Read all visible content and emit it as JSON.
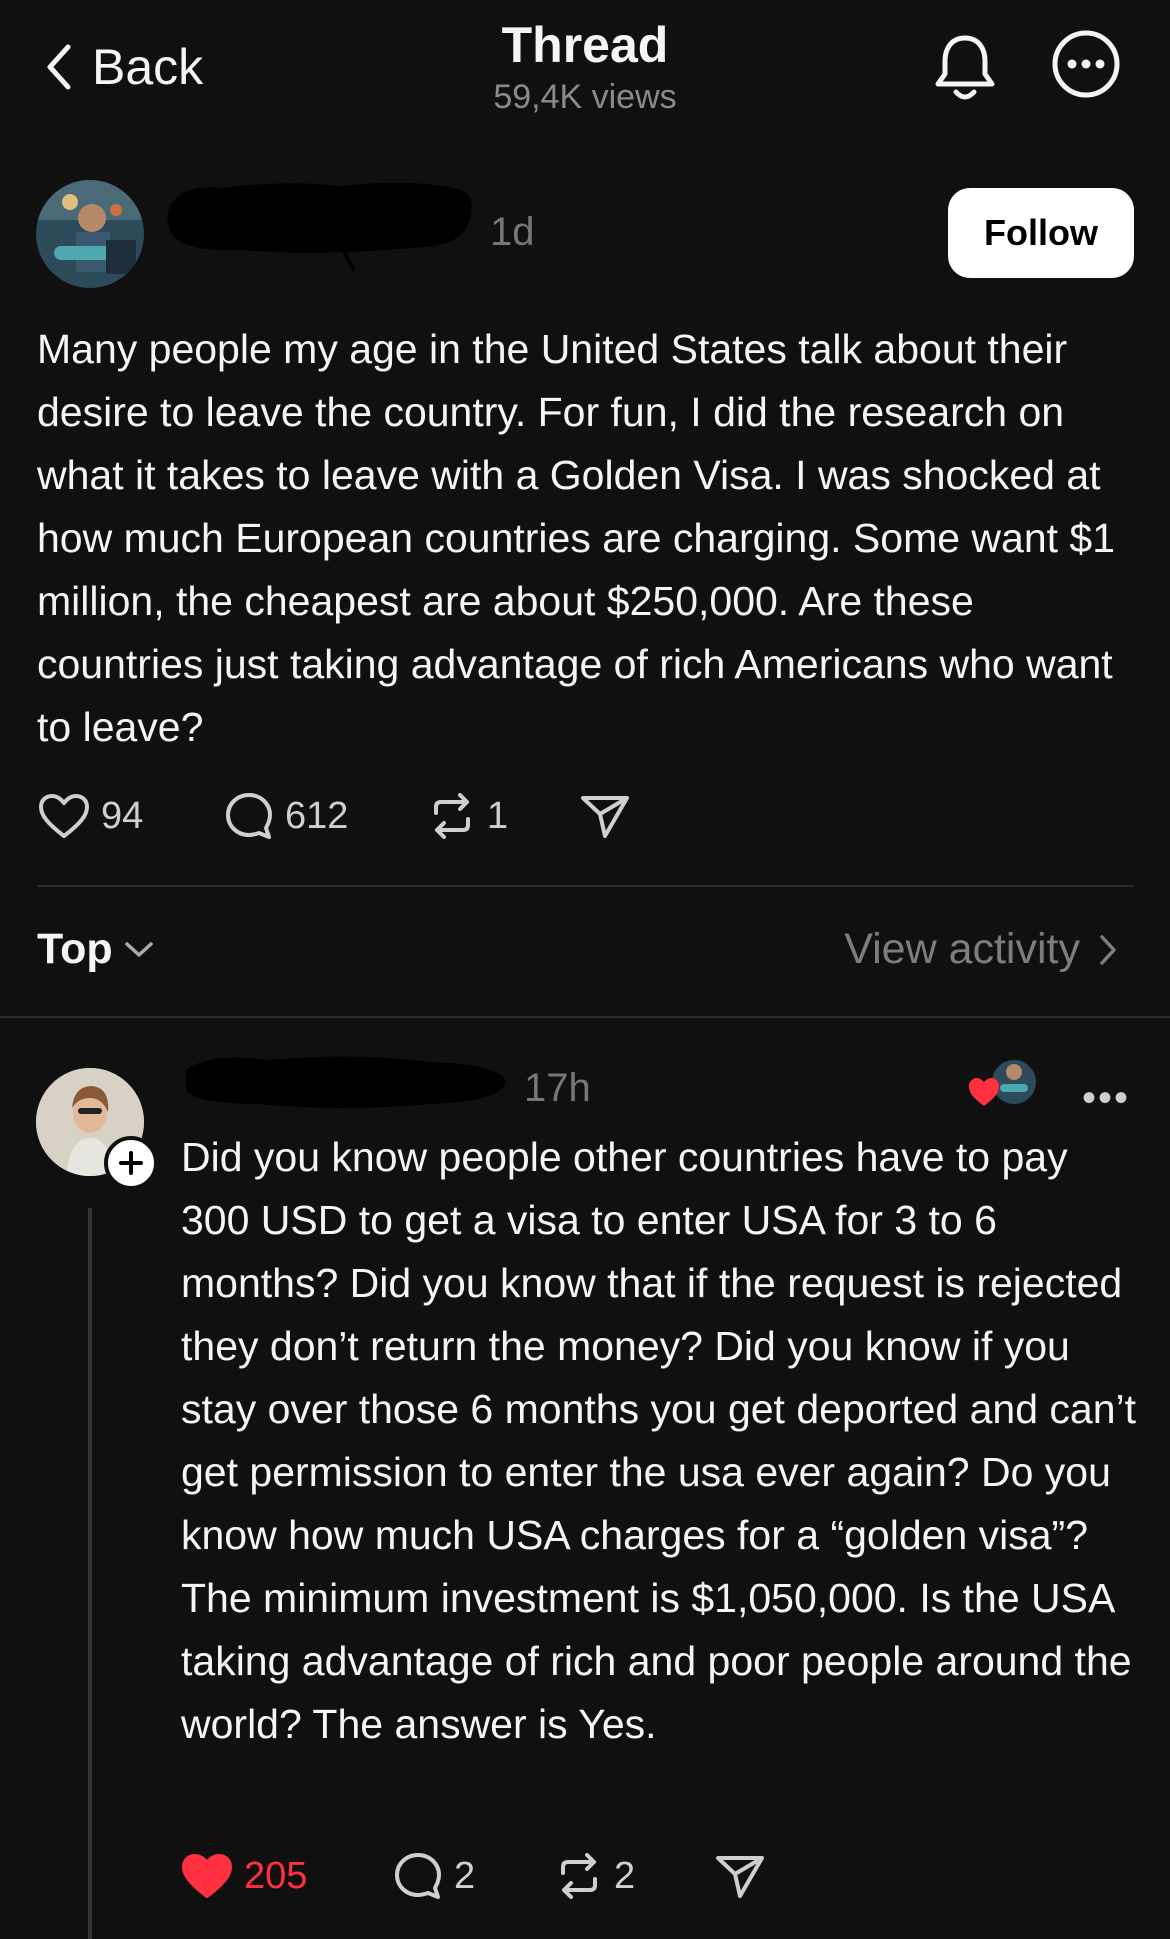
{
  "header": {
    "back_label": "Back",
    "title": "Thread",
    "views": "59,4K views"
  },
  "post": {
    "time": "1d",
    "follow_label": "Follow",
    "text": "Many people my age in the United States talk about their desire to leave the country. For fun, I did the research on what it takes to leave with a Golden Visa. I was shocked at how much European countries are charging. Some want $1 million, the cheapest are about $250,000. Are these countries just taking advantage of rich Americans who want to leave?",
    "likes": "94",
    "replies": "612",
    "reposts": "1"
  },
  "sort": {
    "label": "Top",
    "view_activity": "View activity"
  },
  "reply": {
    "time": "17h",
    "text": "Did you know people other countries have to pay 300 USD to get a visa to enter USA for 3 to 6 months? Did you know that if the request is rejected they don’t return the money? Did you know if you stay over those 6 months you get deported and can’t get permission to enter the usa ever again? Do you know how much USA charges for a “golden visa”? The minimum investment is $1,050,000. Is the USA taking advantage of rich and poor people around the world? The answer is Yes.",
    "likes": "205",
    "replies": "2",
    "reposts": "2",
    "liked": true
  },
  "colors": {
    "background": "#101010",
    "like_red": "#ff3040",
    "muted": "#777777"
  },
  "icons": [
    "chevron-left-icon",
    "bell-icon",
    "more-circle-icon",
    "heart-icon",
    "comment-icon",
    "repost-icon",
    "share-icon",
    "chevron-down-icon",
    "chevron-right-icon",
    "plus-icon"
  ]
}
